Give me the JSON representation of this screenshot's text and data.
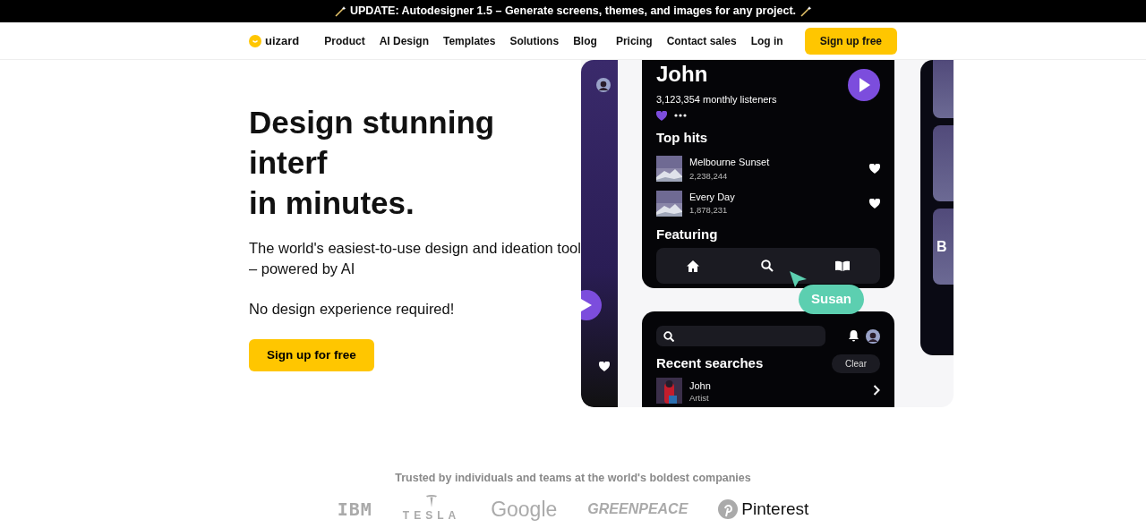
{
  "banner": {
    "text": "UPDATE: Autodesigner 1.5 – Generate screens, themes, and images for any project."
  },
  "nav": {
    "logo": "uizard",
    "links": [
      "Product",
      "AI Design",
      "Templates",
      "Solutions",
      "Blog"
    ],
    "right_links": [
      "Pricing",
      "Contact sales",
      "Log in"
    ],
    "cta": "Sign up free"
  },
  "hero": {
    "title_lines": [
      "Design stunning",
      "interf",
      "in minutes."
    ],
    "subtitle": "The world's easiest-to-use design and ideation tool – powered by AI",
    "note": "No design experience required!",
    "button": "Sign up for free"
  },
  "showcase": {
    "artist": "John",
    "listeners": "3,123,354 monthly listeners",
    "top_hits_title": "Top hits",
    "tracks": [
      {
        "title": "Melbourne Sunset",
        "plays": "2,238,244"
      },
      {
        "title": "Every Day",
        "plays": "1,878,231"
      }
    ],
    "featuring_title": "Featuring",
    "cursor_label": "Susan",
    "recent_title": "Recent searches",
    "clear": "Clear",
    "recent": [
      {
        "name": "John",
        "type": "Artist"
      }
    ],
    "side_label": "B"
  },
  "trusted": {
    "text": "Trusted by individuals and teams at the world's boldest companies",
    "logos": [
      "IBM",
      "TESLA",
      "Google",
      "GREENPEACE",
      "Pinterest"
    ]
  }
}
